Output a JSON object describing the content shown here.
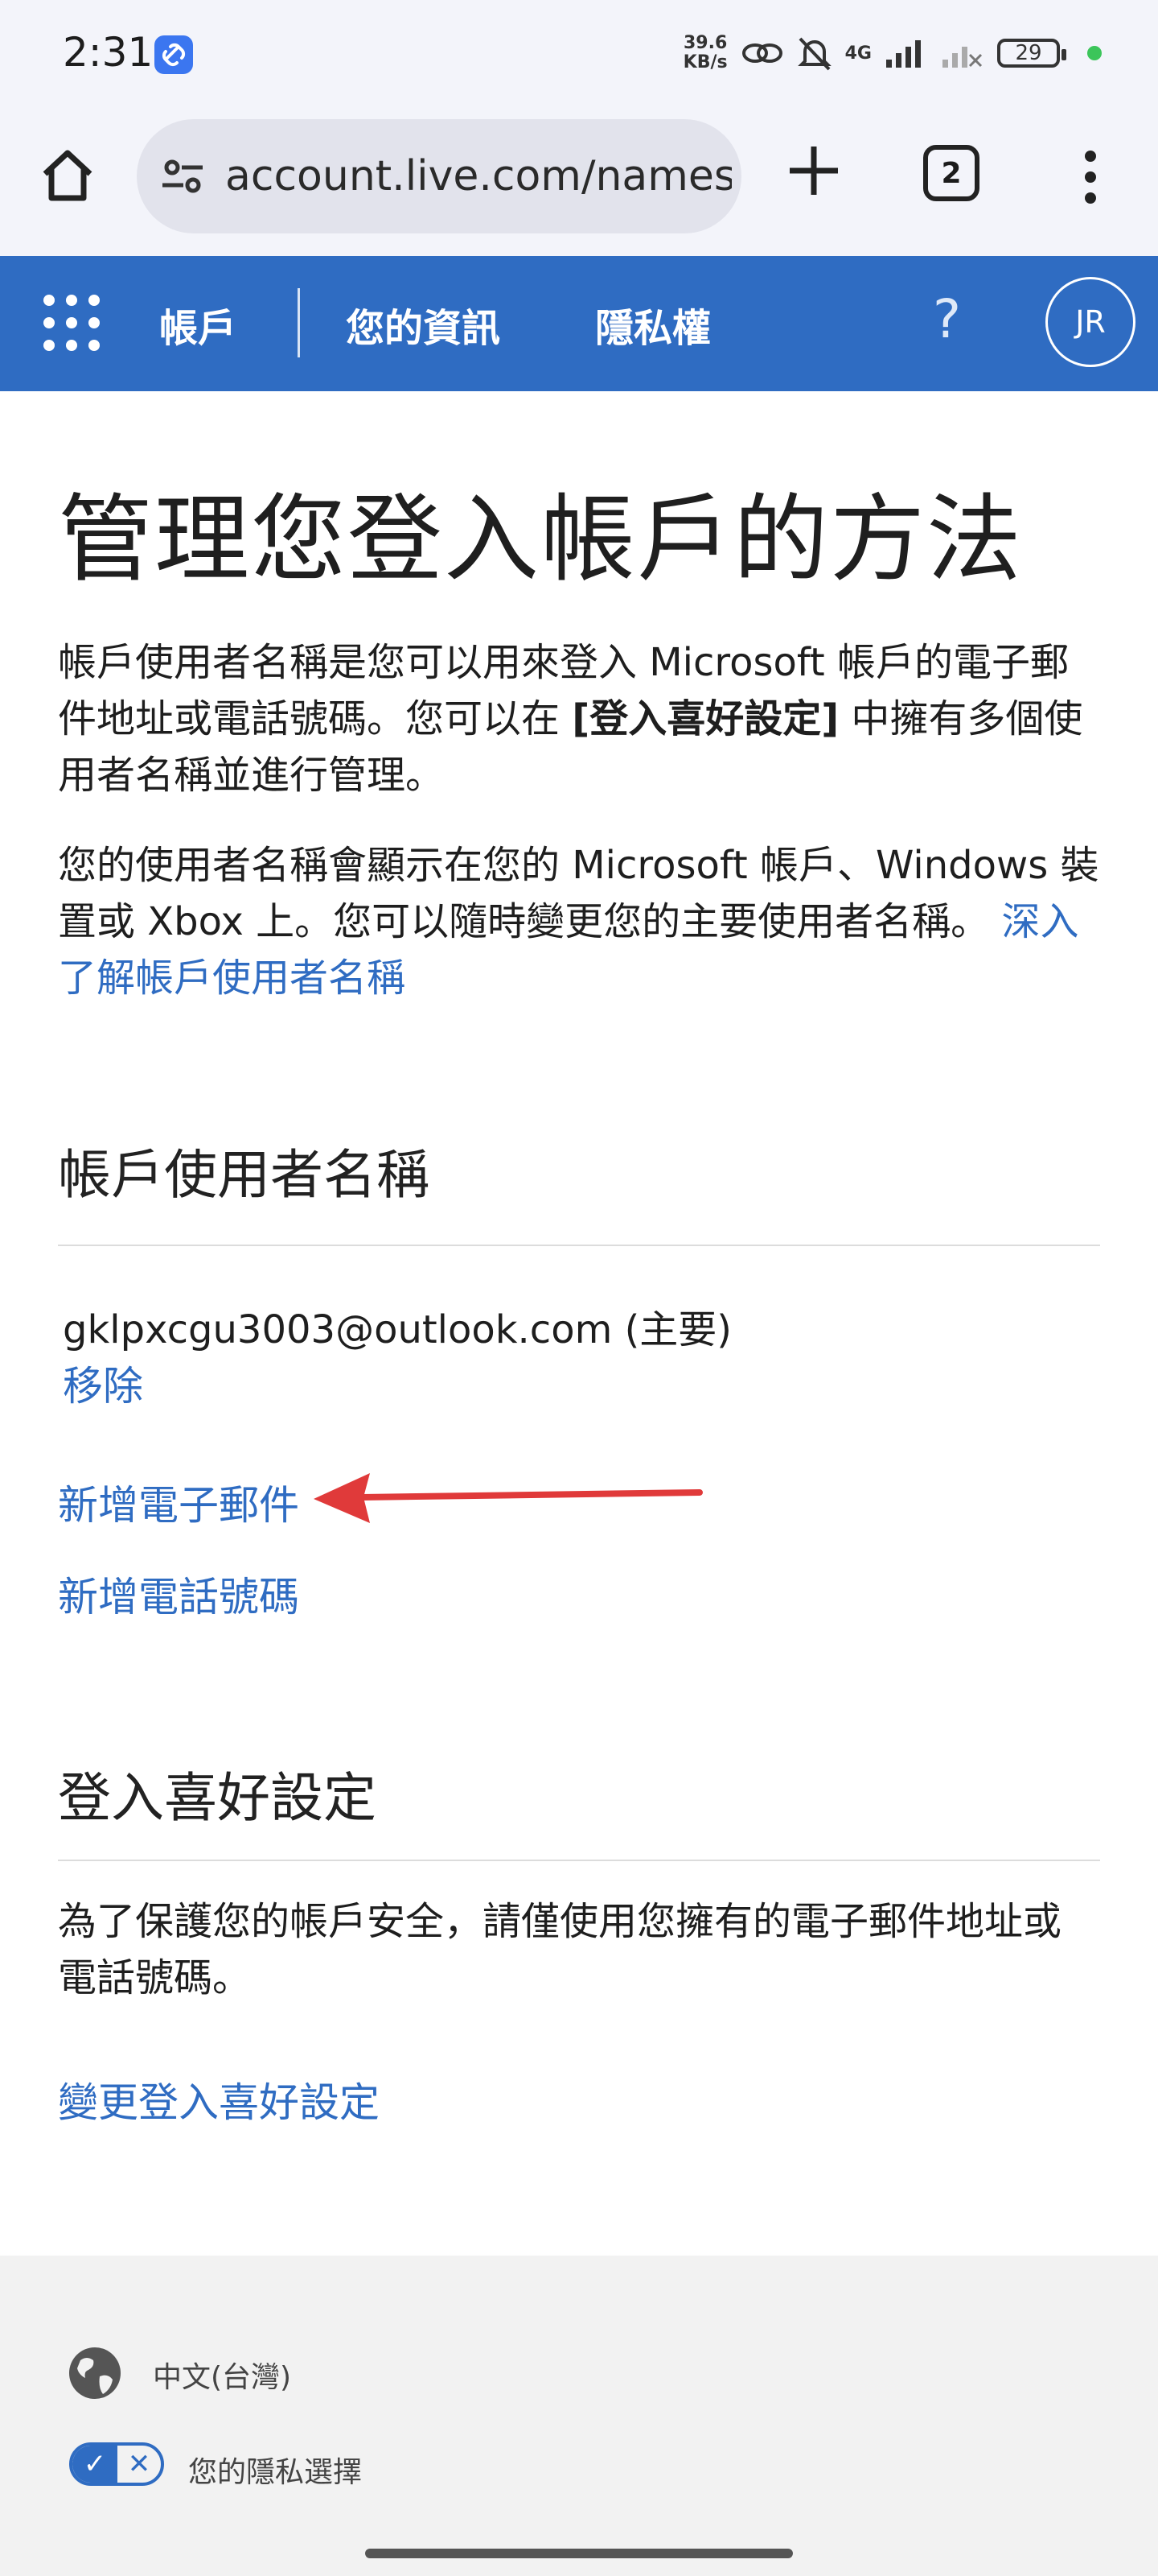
{
  "status_bar": {
    "time": "2:31",
    "network_speed_value": "39.6",
    "network_speed_unit": "KB/s",
    "network_type": "4G",
    "battery": "29"
  },
  "browser": {
    "url": "account.live.com/names",
    "tab_count": "2"
  },
  "header": {
    "account": "帳戶",
    "your_info": "您的資訊",
    "privacy": "隱私權",
    "help": "?",
    "avatar_initials": "JR"
  },
  "main": {
    "title": "管理您登入帳戶的方法",
    "intro_part1": "帳戶使用者名稱是您可以用來登入 Microsoft 帳戶的電子郵件地址或電話號碼。您可以在 ",
    "intro_bold": "[登入喜好設定]",
    "intro_part2": " 中擁有多個使用者名稱並進行管理。",
    "display_text": "您的使用者名稱會顯示在您的 Microsoft 帳戶、Windows 裝置或 Xbox 上。您可以隨時變更您的主要使用者名稱。",
    "learn_more_link": "深入了解帳戶使用者名稱",
    "usernames_heading": "帳戶使用者名稱",
    "primary_email": "gklpxcgu3003@outlook.com (主要)",
    "remove_link": "移除",
    "add_email_link": "新增電子郵件",
    "add_phone_link": "新增電話號碼",
    "signin_pref_heading": "登入喜好設定",
    "signin_pref_text": "為了保護您的帳戶安全，請僅使用您擁有的電子郵件地址或電話號碼。",
    "change_pref_link": "變更登入喜好設定"
  },
  "footer": {
    "language": "中文(台灣)",
    "privacy_choices": "您的隱私選擇"
  },
  "colors": {
    "brand_blue": "#2f6cc2",
    "annotation_arrow": "#e03a3a"
  }
}
